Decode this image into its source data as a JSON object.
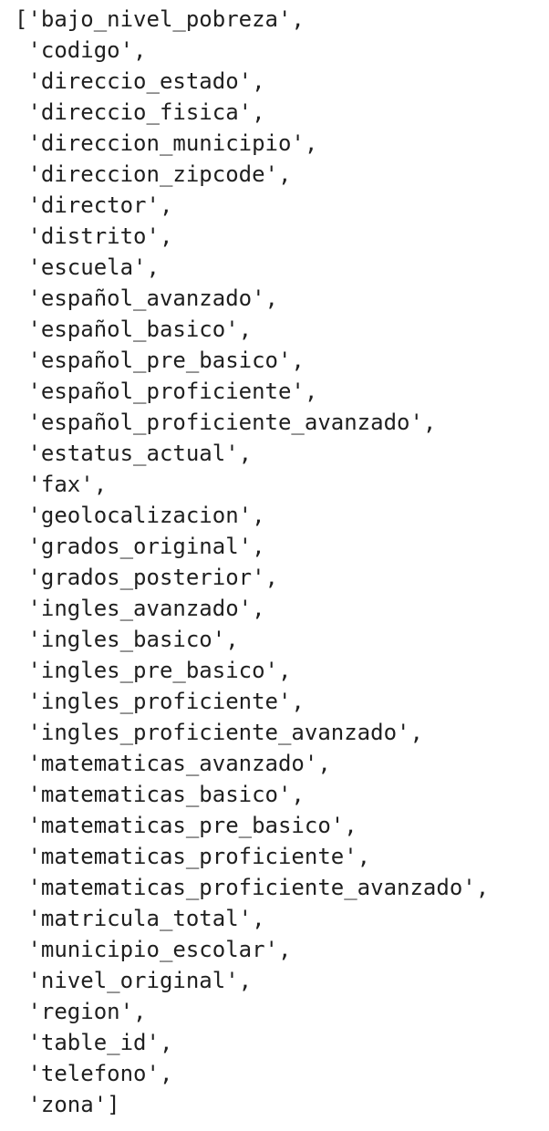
{
  "output": {
    "lines": [
      "['bajo_nivel_pobreza',",
      " 'codigo',",
      " 'direccio_estado',",
      " 'direccio_fisica',",
      " 'direccion_municipio',",
      " 'direccion_zipcode',",
      " 'director',",
      " 'distrito',",
      " 'escuela',",
      " 'español_avanzado',",
      " 'español_basico',",
      " 'español_pre_basico',",
      " 'español_proficiente',",
      " 'español_proficiente_avanzado',",
      " 'estatus_actual',",
      " 'fax',",
      " 'geolocalizacion',",
      " 'grados_original',",
      " 'grados_posterior',",
      " 'ingles_avanzado',",
      " 'ingles_basico',",
      " 'ingles_pre_basico',",
      " 'ingles_proficiente',",
      " 'ingles_proficiente_avanzado',",
      " 'matematicas_avanzado',",
      " 'matematicas_basico',",
      " 'matematicas_pre_basico',",
      " 'matematicas_proficiente',",
      " 'matematicas_proficiente_avanzado',",
      " 'matricula_total',",
      " 'municipio_escolar',",
      " 'nivel_original',",
      " 'region',",
      " 'table_id',",
      " 'telefono',",
      " 'zona']"
    ]
  }
}
